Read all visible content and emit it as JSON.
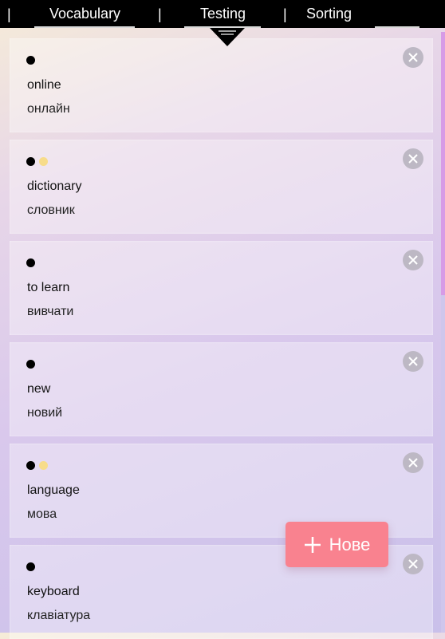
{
  "nav": {
    "separators": [
      "|",
      "|",
      "|"
    ],
    "links": [
      "Vocabulary",
      "Testing",
      "Sorting"
    ]
  },
  "cards": [
    {
      "word": "online",
      "translation": "онлайн",
      "dots": [
        "black"
      ]
    },
    {
      "word": "dictionary",
      "translation": "словник",
      "dots": [
        "black",
        "yellow"
      ]
    },
    {
      "word": "to learn",
      "translation": "вивчати",
      "dots": [
        "black"
      ]
    },
    {
      "word": "new",
      "translation": "новий",
      "dots": [
        "black"
      ]
    },
    {
      "word": "language",
      "translation": "мова",
      "dots": [
        "black",
        "yellow"
      ]
    },
    {
      "word": "keyboard",
      "translation": "клавіатура",
      "dots": [
        "black"
      ]
    }
  ],
  "fab": {
    "label": "Нове",
    "icon": "plus-icon"
  },
  "colors": {
    "nav_bg": "#000000",
    "fab_bg": "#f9828f",
    "dot_black": "#000000",
    "dot_yellow": "#f7dc8a",
    "close_bg": "#bdb8c4"
  }
}
